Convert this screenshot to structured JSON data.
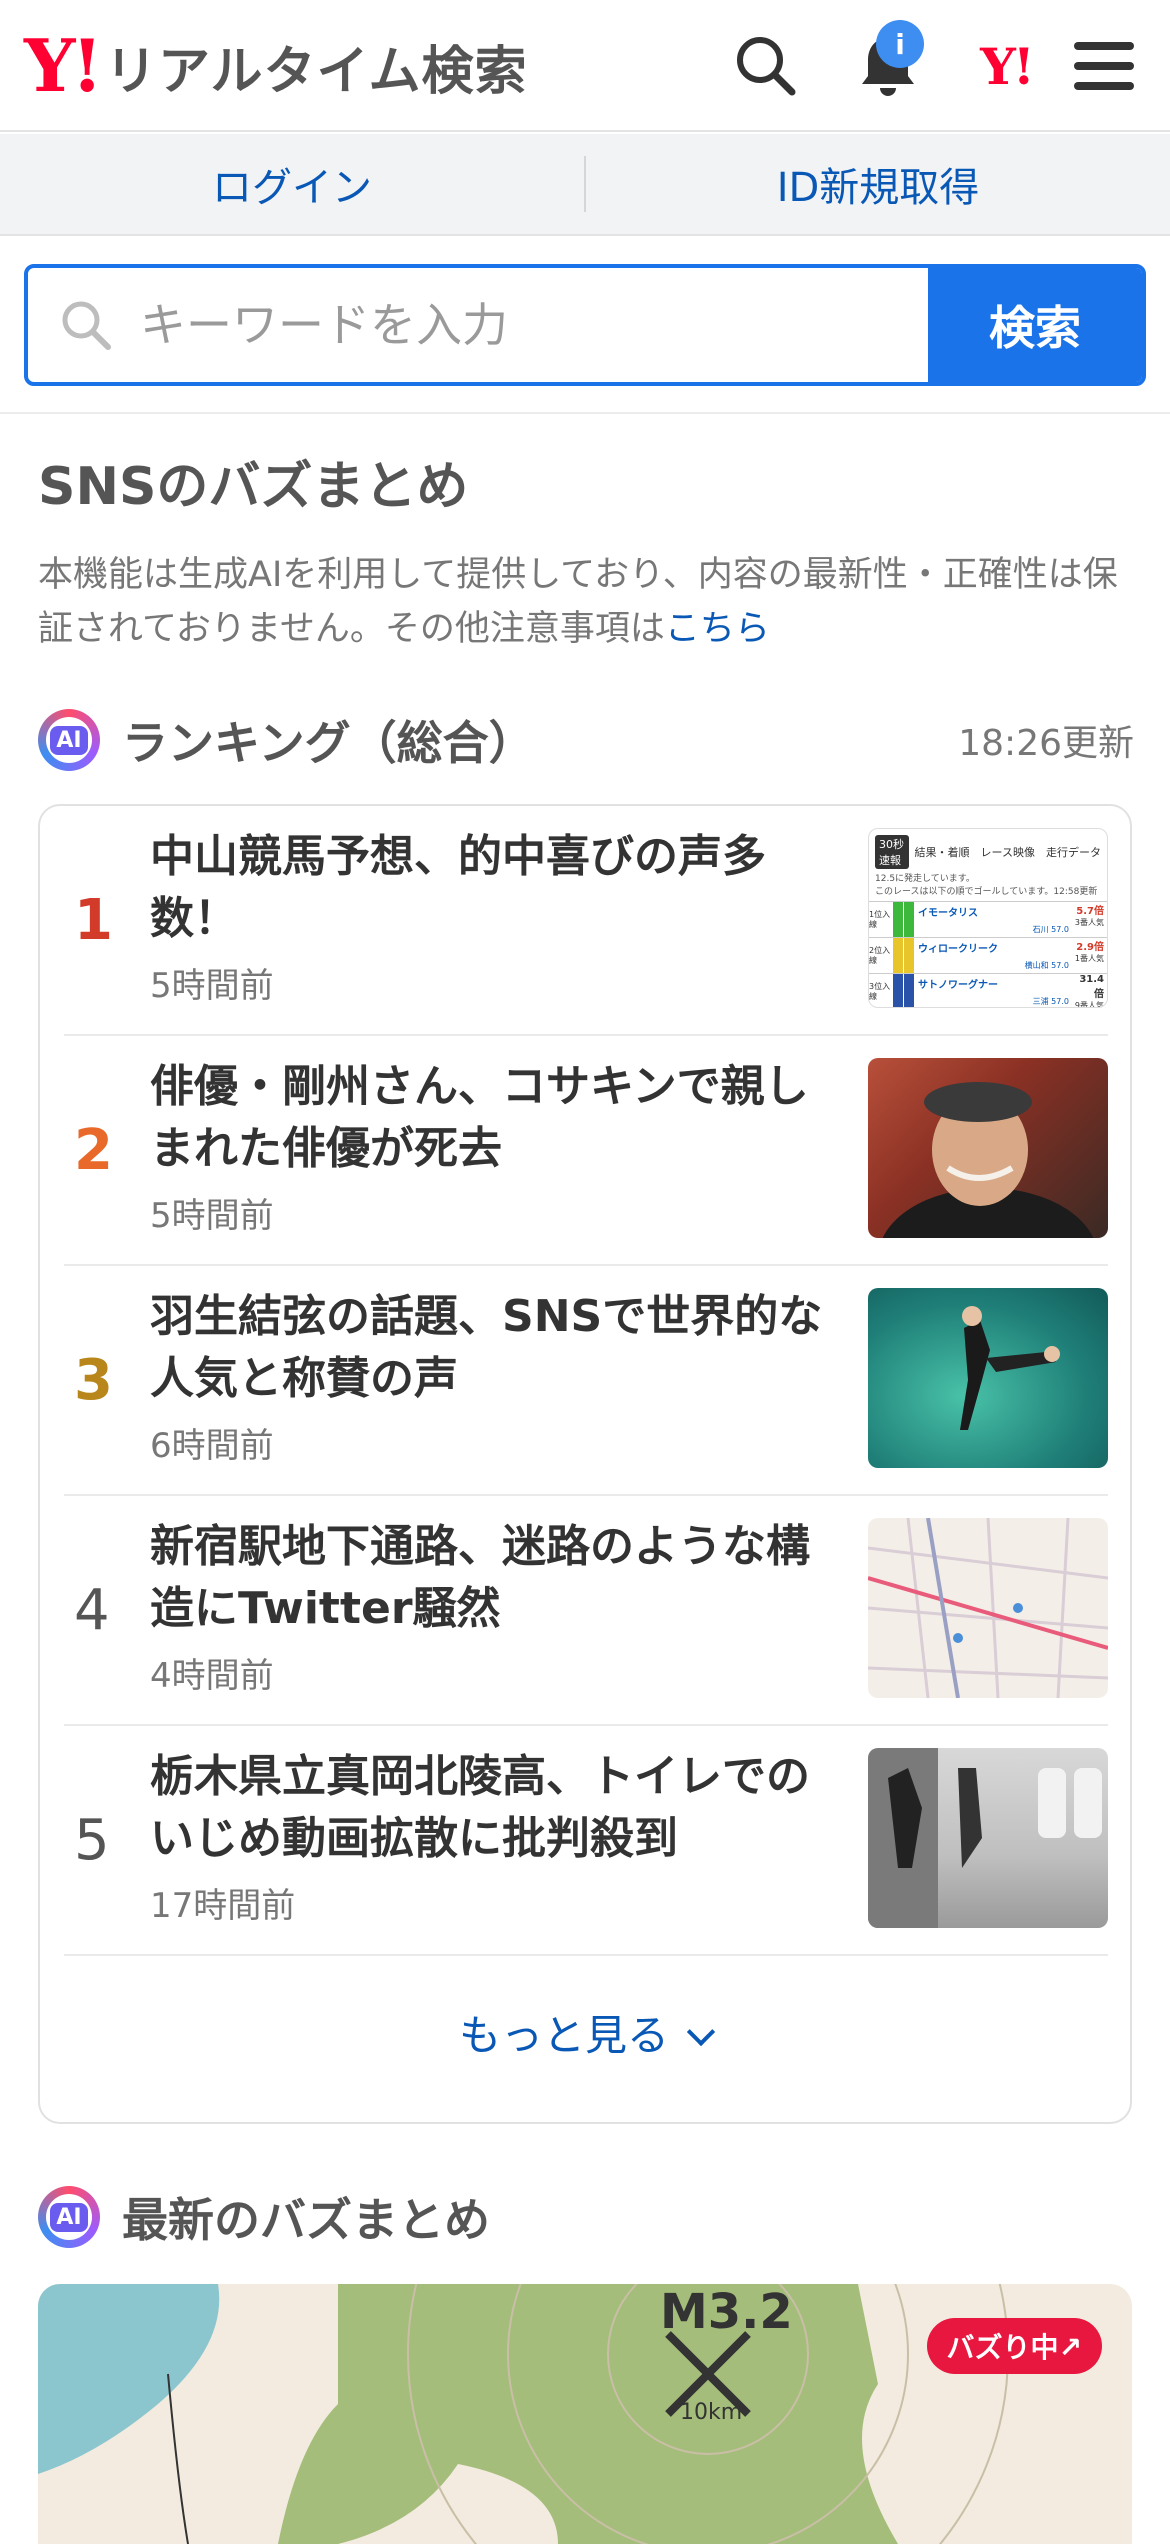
{
  "header": {
    "logo_y": "Y!",
    "logo_text": "リアルタイム検索",
    "notification_badge": "i",
    "yahoo_mark": "Y!"
  },
  "login_bar": {
    "login": "ログイン",
    "register": "ID新規取得"
  },
  "search": {
    "placeholder": "キーワードを入力",
    "button": "検索"
  },
  "section": {
    "title": "SNSのバズまとめ",
    "notice": "本機能は生成AIを利用して提供しており、内容の最新性・正確性は保証されておりません。その他注意事項は",
    "notice_link": "こちら"
  },
  "ranking": {
    "ai_label": "AI",
    "title": "ランキング（総合）",
    "updated": "18:26更新",
    "items": [
      {
        "rank": "1",
        "title": "中山競馬予想、的中喜びの声多数！",
        "time": "5時間前",
        "rank_color": "#d23b2a"
      },
      {
        "rank": "2",
        "title": "俳優・剛州さん、コサキンで親しまれた俳優が死去",
        "time": "5時間前",
        "rank_color": "#e8692a"
      },
      {
        "rank": "3",
        "title": "羽生結弦の話題、SNSで世界的な人気と称賛の声",
        "time": "6時間前",
        "rank_color": "#b8861b"
      },
      {
        "rank": "4",
        "title": "新宿駅地下通路、迷路のような構造にTwitter騒然",
        "time": "4時間前",
        "rank_color": "#555555"
      },
      {
        "rank": "5",
        "title": "栃木県立真岡北陵高、トイレでのいじめ動画拡散に批判殺到",
        "time": "17時間前",
        "rank_color": "#555555"
      }
    ],
    "more": "もっと見る"
  },
  "latest": {
    "ai_label": "AI",
    "title": "最新のバズまとめ",
    "buzz_badge": "バズり中↗",
    "map_label": "M3.2",
    "map_scale": "10km"
  },
  "thumb1": {
    "tag": "30秒速報",
    "header": "結果・着順　レース映像　走行データ",
    "note1": "12.5に発走しています。",
    "note2": "このレースは以下の順でゴールしています。12:58更新",
    "rows": [
      {
        "place": "1位入線",
        "name": "イモータリス",
        "jockey": "石川 57.0",
        "odds": "5.7倍",
        "pop": "3番人気"
      },
      {
        "place": "2位入線",
        "name": "ウィロークリーク",
        "jockey": "横山和 57.0",
        "odds": "2.9倍",
        "pop": "1番人気"
      },
      {
        "place": "3位入線",
        "name": "サトノワーグナー",
        "jockey": "三浦 57.0",
        "odds": "31.4倍",
        "pop": "9番人気"
      }
    ]
  }
}
